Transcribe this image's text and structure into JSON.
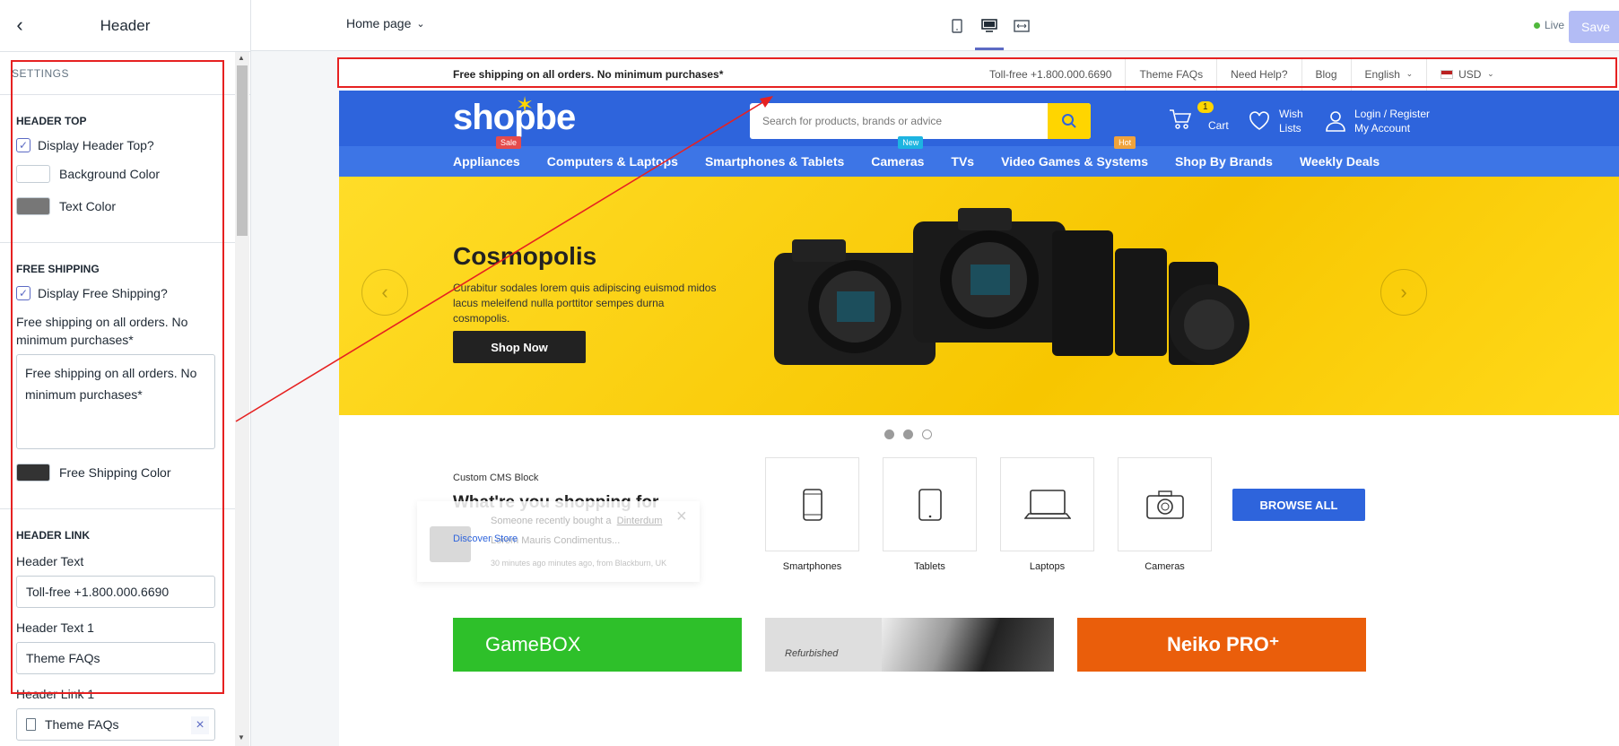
{
  "sidebar": {
    "title": "Header",
    "settings_label": "SETTINGS",
    "header_top": {
      "heading": "HEADER TOP",
      "display_label": "Display Header Top?",
      "bg_color_label": "Background Color",
      "text_color_label": "Text Color",
      "bg_color": "#ffffff",
      "text_color": "#777777"
    },
    "free_shipping": {
      "heading": "FREE SHIPPING",
      "display_label": "Display Free Shipping?",
      "field_label": "Free shipping on all orders. No minimum purchases*",
      "field_value": "Free shipping on all orders. No minimum purchases*",
      "color_label": "Free Shipping Color",
      "color": "#333333"
    },
    "header_link": {
      "heading": "HEADER LINK",
      "text_label": "Header Text",
      "text_value": "Toll-free +1.800.000.6690",
      "text1_label": "Header Text 1",
      "text1_value": "Theme FAQs",
      "link1_label": "Header Link 1",
      "link1_value": "Theme FAQs"
    }
  },
  "topbar": {
    "page": "Home page",
    "live": "Live",
    "save": "Save"
  },
  "store": {
    "top": {
      "shipping": "Free shipping on all orders. No minimum purchases*",
      "phone": "Toll-free +1.800.000.6690",
      "faqs": "Theme FAQs",
      "help": "Need Help?",
      "blog": "Blog",
      "language": "English",
      "currency": "USD"
    },
    "logo": "shopbe",
    "search_placeholder": "Search for products, brands or advice",
    "cart": {
      "count": "1",
      "label": "Cart"
    },
    "wish": {
      "line1": "Wish",
      "line2": "Lists"
    },
    "account": {
      "line1": "Login / Register",
      "line2": "My Account"
    },
    "nav": [
      "Appliances",
      "Computers & Laptops",
      "Smartphones & Tablets",
      "Cameras",
      "TVs",
      "Video Games & Systems",
      "Shop By Brands",
      "Weekly Deals"
    ],
    "badges": {
      "sale": "Sale",
      "new": "New",
      "hot": "Hot"
    },
    "hero": {
      "title": "Cosmopolis",
      "text": "Curabitur sodales lorem quis adipiscing euismod midos lacus meleifend nulla porttitor sempes durna cosmopolis.",
      "button": "Shop Now"
    },
    "cms": {
      "label": "Custom CMS Block",
      "title": "What're you shopping for"
    },
    "categories": [
      "Smartphones",
      "Tablets",
      "Laptops",
      "Cameras"
    ],
    "browse": "BROWSE ALL",
    "popup": {
      "someone": "Someone recently bought a",
      "buyer": "Dinterdum",
      "product": "Lorem Mauris Condimentus...",
      "when": "30 minutes ago minutes ago, from Blackburn, UK",
      "discover": "Discover Store"
    },
    "banners": {
      "gamebox": "GameBOX",
      "refurbished": "Refurbished",
      "neiko": "Neiko PRO⁺"
    }
  }
}
